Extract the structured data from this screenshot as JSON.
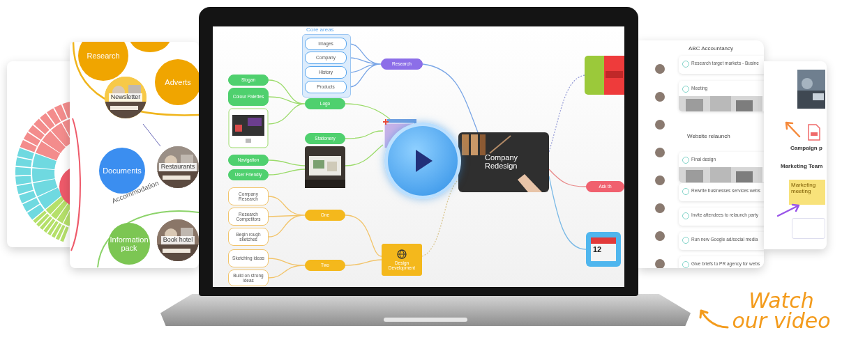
{
  "bubble_map": {
    "ring_label": "Accommodation",
    "bubbles": [
      {
        "label": "Research",
        "kind": "solid",
        "color": "#f0a500"
      },
      {
        "label": "Adverts",
        "kind": "solid",
        "color": "#f0a500"
      },
      {
        "label": "Newsletter",
        "color": "#f7c948"
      },
      {
        "label": "Documents",
        "kind": "solid",
        "color": "#3b8ef0"
      },
      {
        "label": "Restaurants",
        "color": "#9a8f86"
      },
      {
        "label": "Information pack",
        "kind": "solid",
        "color": "#7cc653"
      },
      {
        "label": "Book hotel",
        "color": "#8a7668"
      }
    ]
  },
  "mind_map": {
    "header": "Core areas",
    "central": "Company Redesign",
    "nodes": [
      {
        "label": "Images",
        "kind": "outline",
        "color": "#5aa7ee"
      },
      {
        "label": "Company",
        "kind": "outline",
        "color": "#5aa7ee"
      },
      {
        "label": "History",
        "kind": "outline",
        "color": "#5aa7ee"
      },
      {
        "label": "Products",
        "kind": "outline",
        "color": "#5aa7ee"
      },
      {
        "label": "Research",
        "kind": "filled",
        "color": "#8c6ee8"
      },
      {
        "label": "Slogan",
        "kind": "filled",
        "color": "#4fd06e"
      },
      {
        "label": "Colour Palettes",
        "kind": "filled",
        "color": "#4fd06e"
      },
      {
        "label": "Logo",
        "kind": "filled",
        "color": "#4fd06e"
      },
      {
        "label": "Stationery",
        "kind": "filled",
        "color": "#4fd06e"
      },
      {
        "label": "Navigation",
        "kind": "filled",
        "color": "#4fd06e"
      },
      {
        "label": "User Friendly",
        "kind": "filled",
        "color": "#4fd06e"
      },
      {
        "label": "Company Research",
        "kind": "outline",
        "color": "#f2c46a"
      },
      {
        "label": "Research Competitors",
        "kind": "outline",
        "color": "#f2c46a"
      },
      {
        "label": "Begin rough sketches",
        "kind": "outline",
        "color": "#f2c46a"
      },
      {
        "label": "Sketching ideas",
        "kind": "outline",
        "color": "#f2c46a"
      },
      {
        "label": "Build on strong ideas",
        "kind": "outline",
        "color": "#f2c46a"
      },
      {
        "label": "One",
        "kind": "filled",
        "color": "#f4b81c"
      },
      {
        "label": "Two",
        "kind": "filled",
        "color": "#f4b81c"
      },
      {
        "label": "Design Development",
        "kind": "filled",
        "color": "#f4b81c"
      },
      {
        "label": "Ask th",
        "kind": "filled",
        "color": "#f0606e"
      }
    ]
  },
  "task_board": {
    "title": "ABC Accountancy",
    "section": "Website relaunch",
    "tasks": [
      {
        "label": "Research target markets - Busine",
        "kind": "plain"
      },
      {
        "label": "Meeting"
      },
      {
        "label": "Final design"
      },
      {
        "label": "Rewrite businesses services webs",
        "kind": "plain"
      },
      {
        "label": "Invite attendees to relaunch party",
        "kind": "plain"
      },
      {
        "label": "Run new Google ad/social media",
        "kind": "plain"
      },
      {
        "label": "Give briefs to PR agency for webs",
        "kind": "plain"
      }
    ]
  },
  "whiteboard": {
    "file": "Campaign p",
    "title": "Marketing Team",
    "note": "Marketing meeting"
  },
  "calendar_date": "12",
  "call_to_action": "Watch our video"
}
